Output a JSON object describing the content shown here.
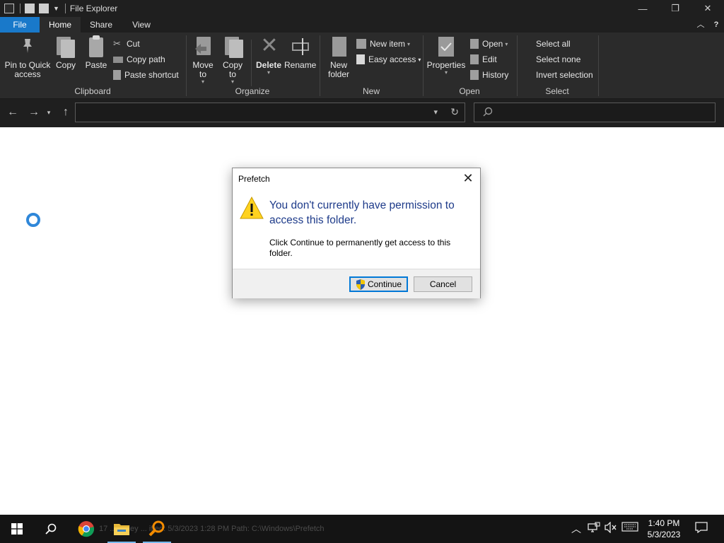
{
  "window": {
    "title": "File Explorer",
    "controls": {
      "minimize": "—",
      "restore": "❐",
      "close": "✕"
    }
  },
  "tabs": [
    {
      "label": "File"
    },
    {
      "label": "Home"
    },
    {
      "label": "Share"
    },
    {
      "label": "View"
    }
  ],
  "ribbon": {
    "clipboard": {
      "label": "Clipboard",
      "pin_label": "Pin to Quick access",
      "copy_label": "Copy",
      "paste_label": "Paste",
      "cut_label": "Cut",
      "copy_path_label": "Copy path",
      "paste_shortcut_label": "Paste shortcut"
    },
    "organize": {
      "label": "Organize",
      "move_to_label": "Move to",
      "copy_to_label": "Copy to",
      "delete_label": "Delete",
      "rename_label": "Rename"
    },
    "new": {
      "label": "New",
      "new_folder_label": "New folder",
      "new_item_label": "New item",
      "easy_access_label": "Easy access"
    },
    "open": {
      "label": "Open",
      "properties_label": "Properties",
      "open_label": "Open",
      "edit_label": "Edit",
      "history_label": "History"
    },
    "select": {
      "label": "Select",
      "select_all_label": "Select all",
      "select_none_label": "Select none",
      "invert_selection_label": "Invert selection"
    }
  },
  "address_bar": {
    "value": ""
  },
  "search": {
    "placeholder": ""
  },
  "dialog": {
    "title": "Prefetch",
    "main_message": "You don't currently have permission to access this folder.",
    "sub_message": "Click Continue to permanently get access to this folder.",
    "continue_label": "Continue",
    "cancel_label": "Cancel"
  },
  "taskbar": {
    "ghost_status": "17 ... Daley ... ified: 5/3/2023 1:28 PM   Path: C:\\Windows\\Prefetch",
    "time": "1:40 PM",
    "date": "5/3/2023"
  },
  "colors": {
    "file_tab": "#1979ca",
    "accent": "#0078d7",
    "dialog_text": "#1e3b8a",
    "ribbon_bg": "#2b2b2b"
  }
}
